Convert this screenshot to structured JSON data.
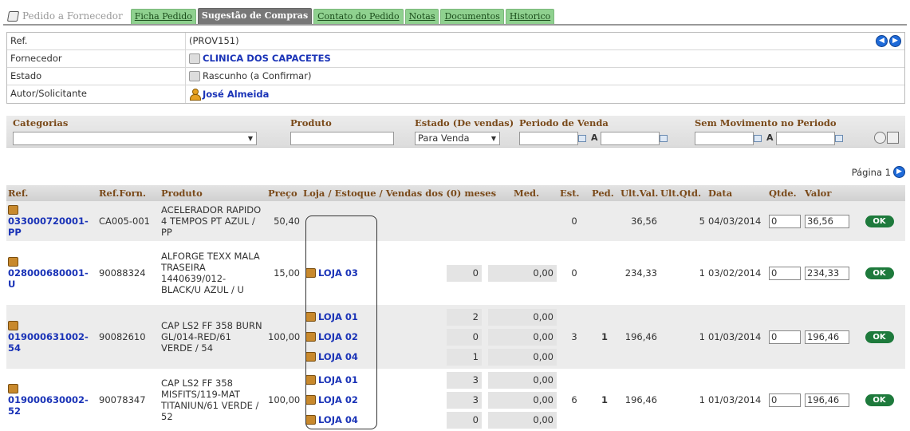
{
  "tabs": {
    "title": "Pedido a Fornecedor",
    "items": [
      "Ficha Pedido",
      "Sugestão de Compras",
      "Contato do Pedido",
      "Notas",
      "Documentos",
      "Historico"
    ]
  },
  "info": {
    "ref_label": "Ref.",
    "ref_value": "(PROV151)",
    "fornecedor_label": "Fornecedor",
    "fornecedor_value": "CLINICA DOS CAPACETES",
    "estado_label": "Estado",
    "estado_value": "Rascunho (a Confirmar)",
    "autor_label": "Autor/Solicitante",
    "autor_value": "José Almeida"
  },
  "filters": {
    "categorias": "Categorias",
    "produto": "Produto",
    "estado": "Estado (De vendas)",
    "estado_value": "Para Venda",
    "periodo": "Periodo de Venda",
    "sem_mov": "Sem Movimento no Periodo",
    "a": "A"
  },
  "page": {
    "label": "Página 1"
  },
  "columns": [
    "Ref.",
    "Ref.Forn.",
    "Produto",
    "Preço",
    "Loja / Estoque / Vendas dos (0) meses",
    "Med.",
    "Est.",
    "Ped.",
    "Ult.Val.",
    "Ult.Qtd.",
    "Data",
    "Qtde.",
    "Valor"
  ],
  "rows": [
    {
      "ref": "033000720001-PP",
      "ref_forn": "CA005-001",
      "produto": "ACELERADOR RAPIDO 4 TEMPOS PT AZUL / PP",
      "preco": "50,40",
      "lojas": [],
      "est": "0",
      "ped": "",
      "ult_val": "36,56",
      "ult_qtd": "5",
      "data": "04/03/2014",
      "qtde": "0",
      "valor": "36,56",
      "ok": "OK"
    },
    {
      "ref": "028000680001-U",
      "ref_forn": "90088324",
      "produto": "ALFORGE TEXX MALA TRASEIRA 1440639/012-BLACK/U AZUL / U",
      "preco": "15,00",
      "lojas": [
        {
          "name": "LOJA 03",
          "q": "0",
          "med": "0,00"
        }
      ],
      "est": "0",
      "ped": "",
      "ult_val": "234,33",
      "ult_qtd": "1",
      "data": "03/02/2014",
      "qtde": "0",
      "valor": "234,33",
      "ok": "OK"
    },
    {
      "ref": "019000631002-54",
      "ref_forn": "90082610",
      "produto": "CAP LS2 FF 358 BURN GL/014-RED/61 VERDE / 54",
      "preco": "100,00",
      "lojas": [
        {
          "name": "LOJA 01",
          "q": "2",
          "med": "0,00"
        },
        {
          "name": "LOJA 02",
          "q": "0",
          "med": "0,00"
        },
        {
          "name": "LOJA 04",
          "q": "1",
          "med": "0,00"
        }
      ],
      "est": "3",
      "ped": "1",
      "ult_val": "196,46",
      "ult_qtd": "1",
      "data": "01/03/2014",
      "qtde": "0",
      "valor": "196,46",
      "ok": "OK"
    },
    {
      "ref": "019000630002-52",
      "ref_forn": "90078347",
      "produto": "CAP LS2 FF 358 MISFITS/119-MAT TITANIUN/61 VERDE / 52",
      "preco": "100,00",
      "lojas": [
        {
          "name": "LOJA 01",
          "q": "3",
          "med": "0,00"
        },
        {
          "name": "LOJA 02",
          "q": "3",
          "med": "0,00"
        },
        {
          "name": "LOJA 04",
          "q": "0",
          "med": "0,00"
        }
      ],
      "est": "6",
      "ped": "1",
      "ult_val": "196,46",
      "ult_qtd": "1",
      "data": "01/03/2014",
      "qtde": "0",
      "valor": "196,46",
      "ok": "OK"
    }
  ]
}
